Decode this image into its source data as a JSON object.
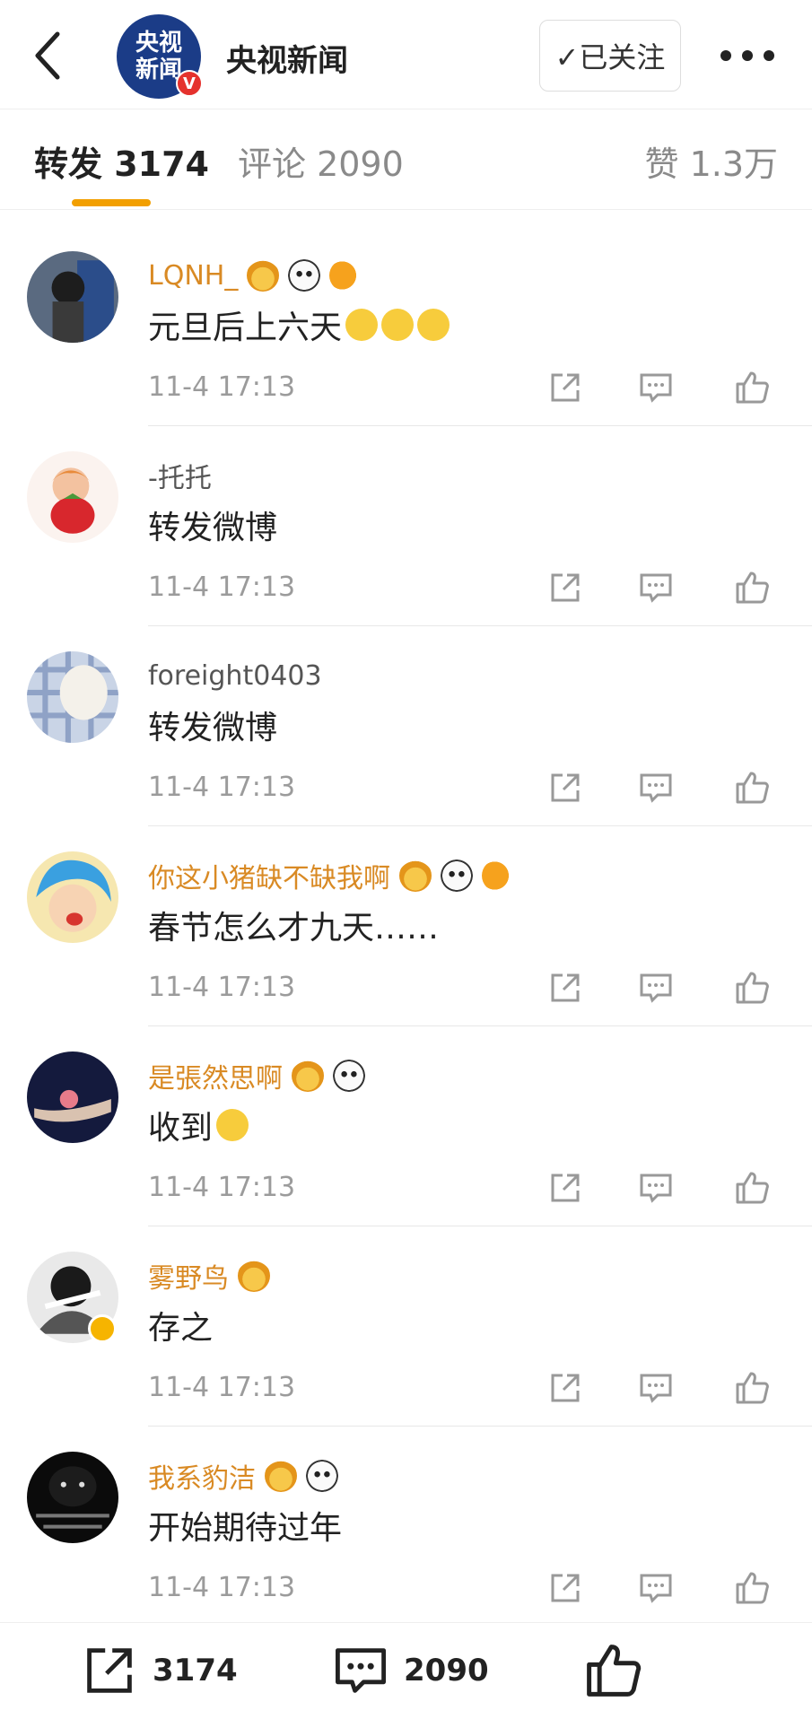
{
  "header": {
    "account_name": "央视新闻",
    "avatar_line1": "央视",
    "avatar_line2": "新闻",
    "verified_mark": "V",
    "follow_label": "✓已关注"
  },
  "tabs": {
    "repost": "转发 3174",
    "comment": "评论 2090",
    "like": "赞 1.3万"
  },
  "reposts": [
    {
      "user": "LQNH_",
      "text": "元旦后上六天",
      "time": "11-4 17:13"
    },
    {
      "user": "-托托",
      "text": "转发微博",
      "time": "11-4 17:13"
    },
    {
      "user": "foreight0403",
      "text": "转发微博",
      "time": "11-4 17:13"
    },
    {
      "user": "你这小猪缺不缺我啊",
      "text": "春节怎么才九天……",
      "time": "11-4 17:13"
    },
    {
      "user": "是張然思啊",
      "text": "收到",
      "time": "11-4 17:13"
    },
    {
      "user": "雾野鸟",
      "text": "存之",
      "time": "11-4 17:13"
    },
    {
      "user": "我系豹洁",
      "text": "开始期待过年",
      "time": "11-4 17:13"
    }
  ],
  "bottom_bar": {
    "repost_count": "3174",
    "comment_count": "2090"
  },
  "colors": {
    "accent": "#f29f00",
    "vip_name": "#d98a24",
    "brand_blue": "#1b3c87"
  },
  "icons": [
    "back-arrow-icon",
    "more-dots-icon",
    "share-icon",
    "comment-icon",
    "thumb-up-icon"
  ]
}
